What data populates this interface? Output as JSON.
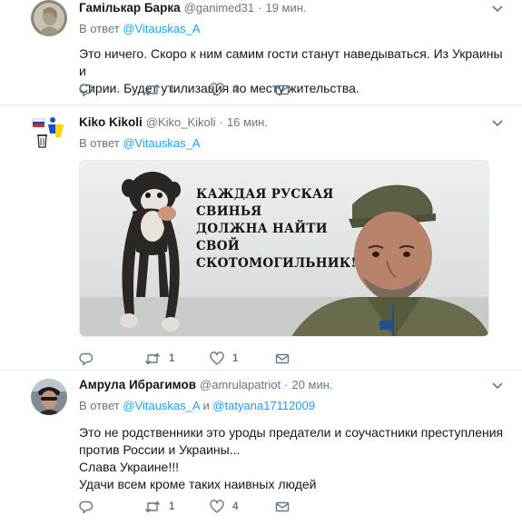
{
  "tweets": [
    {
      "name": "Гамількар Барка",
      "handle": "@ganimed31",
      "dot": "·",
      "time": "19 мин.",
      "reply_prefix": "В ответ",
      "reply_to": [
        "@Vitauskas_A"
      ],
      "text": [
        "Это ничего. Скоро к ним самим гости станут наведываться. Из Украины и",
        "Сирии. Будет утилизация по месту жительства."
      ],
      "replies": "",
      "retweets": "1",
      "likes": "4"
    },
    {
      "name": "Kiko Kikoli",
      "handle": "@Kiko_Kikoli",
      "dot": "·",
      "time": "16 мин.",
      "reply_prefix": "В ответ",
      "reply_to": [
        "@Vitauskas_A"
      ],
      "image_text": [
        "КАЖДАЯ РУСКАЯ",
        "СВИНЬЯ",
        "ДОЛЖНА НАЙТИ",
        "СВОЙ",
        "СКОТОМОГИЛЬНИК!"
      ],
      "replies": "",
      "retweets": "1",
      "likes": "1"
    },
    {
      "name": "Амрула Ибрагимов",
      "handle": "@amrulapatriot",
      "dot": "·",
      "time": "20 мин.",
      "reply_prefix": "В ответ",
      "reply_to": [
        "@Vitauskas_A",
        "@tatyana17112009"
      ],
      "reply_joiner": "и",
      "text": [
        "Это не родственники это уроды предатели и соучастники преступления",
        "против России и Украины...",
        "Слава Украине!!!",
        "Удачи всем кроме таких наивных людей"
      ],
      "replies": "",
      "retweets": "1",
      "likes": "4"
    }
  ],
  "icons": {
    "reply": "reply-icon",
    "retweet": "retweet-icon",
    "like": "heart-icon",
    "dm": "envelope-icon",
    "more": "chevron-down-icon"
  },
  "colors": {
    "link": "#1da1f2",
    "secondary": "#657786",
    "border": "#e6ecf0"
  }
}
